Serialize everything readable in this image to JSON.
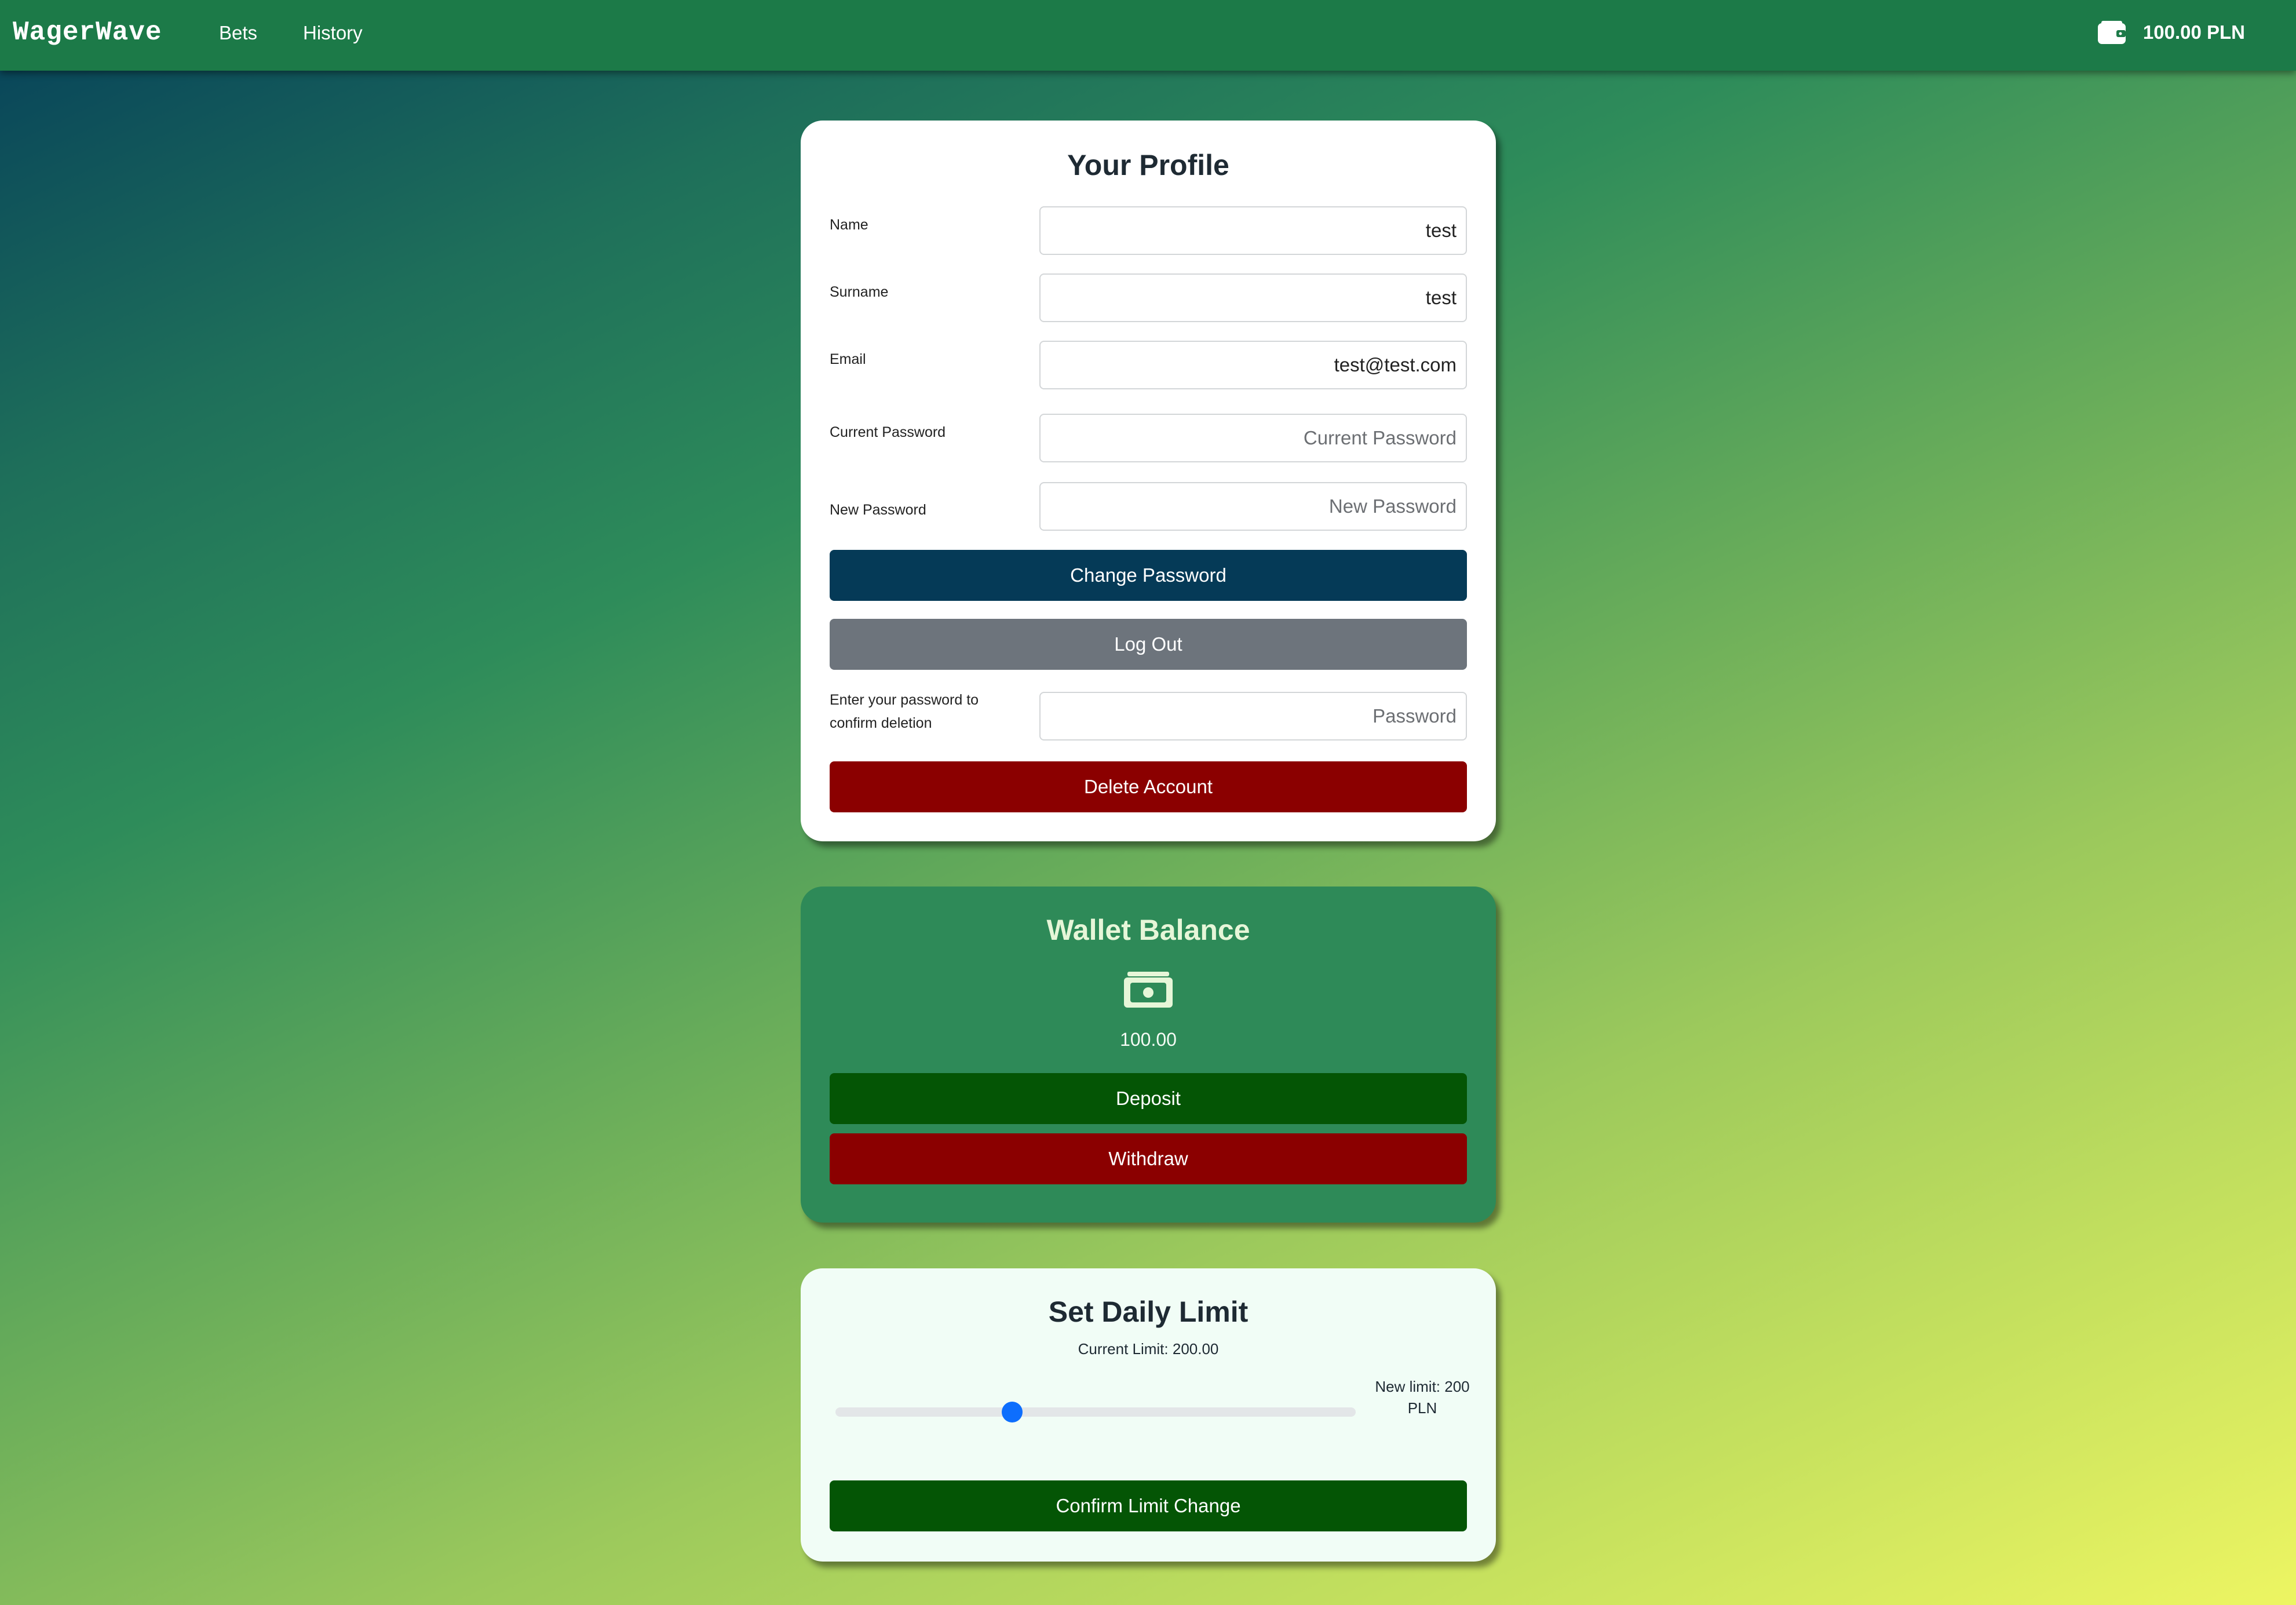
{
  "navbar": {
    "brand": "WagerWave",
    "links": [
      "Bets",
      "History"
    ],
    "wallet_icon": "wallet-icon",
    "wallet_text": "100.00 PLN"
  },
  "profile": {
    "title": "Your Profile",
    "fields": {
      "name": {
        "label": "Name",
        "value": "test"
      },
      "surname": {
        "label": "Surname",
        "value": "test"
      },
      "email": {
        "label": "Email",
        "value": "test@test.com"
      },
      "current_password": {
        "label": "Current Password",
        "placeholder": "Current Password"
      },
      "new_password": {
        "label": "New Password",
        "placeholder": "New Password"
      },
      "delete_password": {
        "label_line1": "Enter your password to",
        "label_line2": "confirm deletion",
        "placeholder": "Password"
      }
    },
    "buttons": {
      "change_password": "Change Password",
      "log_out": "Log Out",
      "delete_account": "Delete Account"
    }
  },
  "wallet": {
    "title": "Wallet Balance",
    "icon": "money-bill-icon",
    "balance": "100.00",
    "buttons": {
      "deposit": "Deposit",
      "withdraw": "Withdraw"
    }
  },
  "limit": {
    "title": "Set Daily Limit",
    "current_limit": "Current Limit: 200.00",
    "slider_fraction": 0.34,
    "new_limit_line1": "New limit: 200",
    "new_limit_line2": "PLN",
    "confirm_button": "Confirm Limit Change"
  },
  "colors": {
    "navbar": "#1c7a48",
    "navy_button": "#053a57",
    "gray_button": "#6d747c",
    "red_button": "#8b0000",
    "green_button": "#045505",
    "wallet_card": "#2e8a58",
    "slider_thumb": "#0d6efd"
  }
}
